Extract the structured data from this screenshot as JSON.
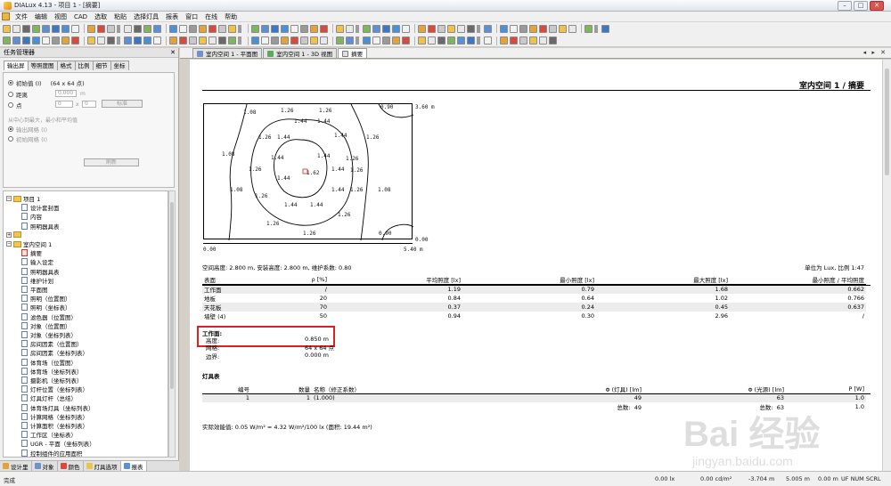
{
  "window": {
    "title": "DIALux 4.13 - 项目 1 - [摘要]",
    "controls": [
      "–",
      "□",
      "✕"
    ]
  },
  "menu": [
    "文件",
    "编辑",
    "视图",
    "CAD",
    "选取",
    "粘贴",
    "选择灯具",
    "报表",
    "窗口",
    "在线",
    "帮助"
  ],
  "left_panel": {
    "title": "任务管理器",
    "close": "✕",
    "tabs": [
      "输出屏",
      "等照度图",
      "格式",
      "比例",
      "细节",
      "坐标"
    ],
    "options": {
      "initial": "初始值 (I)",
      "initial_value": "(64 x 64 点)",
      "distance": "距离",
      "distance_value": "0.000",
      "distance_unit": "m",
      "point": "点",
      "point_x": "0",
      "point_x_label": "x",
      "point_y": "0",
      "standard_button": "标准",
      "hint": "从中心到最大，最小和平均值",
      "output_grid": "输出网格 (I)",
      "initial_grid": "初始网格 (I)",
      "refresh_button": "刷新"
    },
    "tree": [
      {
        "label": "项目 1",
        "level": 0,
        "type": "folder",
        "exp": "−"
      },
      {
        "label": "设计套封面",
        "level": 1,
        "type": "doc"
      },
      {
        "label": "内容",
        "level": 1,
        "type": "doc"
      },
      {
        "label": "照明器具表",
        "level": 1,
        "type": "doc"
      },
      {
        "label": "",
        "level": 0,
        "type": "folder",
        "exp": "+"
      },
      {
        "label": "室内空间 1",
        "level": 0,
        "type": "folder",
        "exp": "−"
      },
      {
        "label": "摘要",
        "level": 1,
        "type": "doc-red"
      },
      {
        "label": "输入设定",
        "level": 1,
        "type": "doc"
      },
      {
        "label": "照明器具表",
        "level": 1,
        "type": "doc"
      },
      {
        "label": "维护计划",
        "level": 1,
        "type": "doc"
      },
      {
        "label": "平面图",
        "level": 1,
        "type": "doc"
      },
      {
        "label": "照明（位置图）",
        "level": 1,
        "type": "doc"
      },
      {
        "label": "照明（坐标表）",
        "level": 1,
        "type": "doc"
      },
      {
        "label": "滤色器（位置图）",
        "level": 1,
        "type": "doc"
      },
      {
        "label": "对象（位置图）",
        "level": 1,
        "type": "doc"
      },
      {
        "label": "对象（坐标列表）",
        "level": 1,
        "type": "doc"
      },
      {
        "label": "房间因素（位置图）",
        "level": 1,
        "type": "doc"
      },
      {
        "label": "房间因素（坐标列表）",
        "level": 1,
        "type": "doc"
      },
      {
        "label": "体育场（位置图）",
        "level": 1,
        "type": "doc"
      },
      {
        "label": "体育场（坐标列表）",
        "level": 1,
        "type": "doc"
      },
      {
        "label": "摄影机（坐标列表）",
        "level": 1,
        "type": "doc"
      },
      {
        "label": "灯杆位置（坐标列表）",
        "level": 1,
        "type": "doc"
      },
      {
        "label": "灯具灯杆（总结）",
        "level": 1,
        "type": "doc"
      },
      {
        "label": "体育场灯具（坐标列表）",
        "level": 1,
        "type": "doc"
      },
      {
        "label": "计算网格（坐标列表）",
        "level": 1,
        "type": "doc"
      },
      {
        "label": "计算面积（坐标列表）",
        "level": 1,
        "type": "doc"
      },
      {
        "label": "工作区（坐标表）",
        "level": 1,
        "type": "doc"
      },
      {
        "label": "UGR - 平面（坐标列表）",
        "level": 1,
        "type": "doc"
      },
      {
        "label": "控制组件的应用面积",
        "level": 1,
        "type": "doc"
      }
    ],
    "bottom_tabs": [
      "设计里",
      "对象",
      "颜色",
      "灯具选项",
      "报表"
    ]
  },
  "doc_tabs": [
    "室内空间 1 - 平面图",
    "室内空间 1 - 3D 视图",
    "摘要"
  ],
  "doc_nav": "◂ ▸ ✕",
  "report": {
    "title": "室内空间 1 / 摘要",
    "figure_labels": {
      "top_right": "3.60 m",
      "bottom_right": "0.00",
      "bottom_left": "0.00",
      "bottom_axis_right": "5.40 m",
      "values": [
        [
          "1.08",
          44,
          57
        ],
        [
          "1.26",
          86,
          55
        ],
        [
          "1.26",
          129,
          55
        ],
        [
          "0.90",
          198,
          51
        ],
        [
          "1.44",
          101,
          67
        ],
        [
          "1.44",
          127,
          67
        ],
        [
          "1.26",
          61,
          85
        ],
        [
          "1.44",
          82,
          85
        ],
        [
          "1.44",
          146,
          83
        ],
        [
          "1.26",
          182,
          85
        ],
        [
          "1.08",
          20,
          104
        ],
        [
          "1.44",
          75,
          108
        ],
        [
          "1.44",
          127,
          106
        ],
        [
          "1.26",
          50,
          121
        ],
        [
          "1.62",
          115,
          125
        ],
        [
          "1.44",
          143,
          121
        ],
        [
          "1.26",
          159,
          109
        ],
        [
          "1.26",
          164,
          122
        ],
        [
          "1.44",
          82,
          131
        ],
        [
          "1.08",
          29,
          144
        ],
        [
          "1.26",
          57,
          151
        ],
        [
          "1.44",
          143,
          144
        ],
        [
          "1.26",
          164,
          144
        ],
        [
          "1.08",
          195,
          144
        ],
        [
          "1.44",
          90,
          161
        ],
        [
          "1.44",
          119,
          161
        ],
        [
          "1.26",
          150,
          172
        ],
        [
          "1.26",
          70,
          182
        ],
        [
          "1.26",
          111,
          193
        ],
        [
          "0.90",
          196,
          193
        ]
      ]
    },
    "info": "空间高度: 2.800 m, 安装高度: 2.800 m, 维护系数: 0.80",
    "scale": "单位为 Lux, 比例 1:47",
    "surfaces_headers": [
      "表面",
      "ρ [%]",
      "平均照度 [lx]",
      "最小照度 [lx]",
      "最大照度 [lx]",
      "最小照度 / 平均照度"
    ],
    "surfaces": [
      [
        "工作面",
        "/",
        "1.19",
        "0.79",
        "1.68",
        "0.662"
      ],
      [
        "地板",
        "20",
        "0.84",
        "0.64",
        "1.02",
        "0.766"
      ],
      [
        "天花板",
        "70",
        "0.37",
        "0.24",
        "0.45",
        "0.637"
      ],
      [
        "墙壁 (4)",
        "50",
        "0.94",
        "0.30",
        "2.96",
        "/"
      ]
    ],
    "workplane": {
      "heading": "工作面:",
      "height_label": "高度:",
      "height_value": "0.850 m",
      "grid_label": "网格:",
      "grid_value": "64 x 64 点",
      "boundary_label": "边界:",
      "boundary_value": "0.000 m"
    },
    "luminaire_heading": "灯具表",
    "lum_headers": [
      "编号",
      "数量",
      "名称（修正系数）",
      "Φ (灯具) [lm]",
      "Φ (光源) [lm]",
      "P [W]"
    ],
    "lum_rows": [
      [
        "1",
        "1",
        "(1.000)",
        "49",
        "63",
        "1.0"
      ]
    ],
    "lum_total": [
      "总数:",
      "49",
      "总数:",
      "63",
      "1.0"
    ],
    "power_density": "实际效能值: 0.05 W/m² = 4.32 W/m²/100 lx (面积: 19.44 m²)"
  },
  "status": {
    "left": "完成",
    "lux": "0.00 lx",
    "lum": "0.00 cd/m²",
    "x": "-3.704 m",
    "y": "5.005 m",
    "z": "0.00 m",
    "flags": "UF NUM SCRL"
  },
  "watermark": {
    "text": "Bai 经验",
    "sub": "jingyan.baidu.com"
  }
}
